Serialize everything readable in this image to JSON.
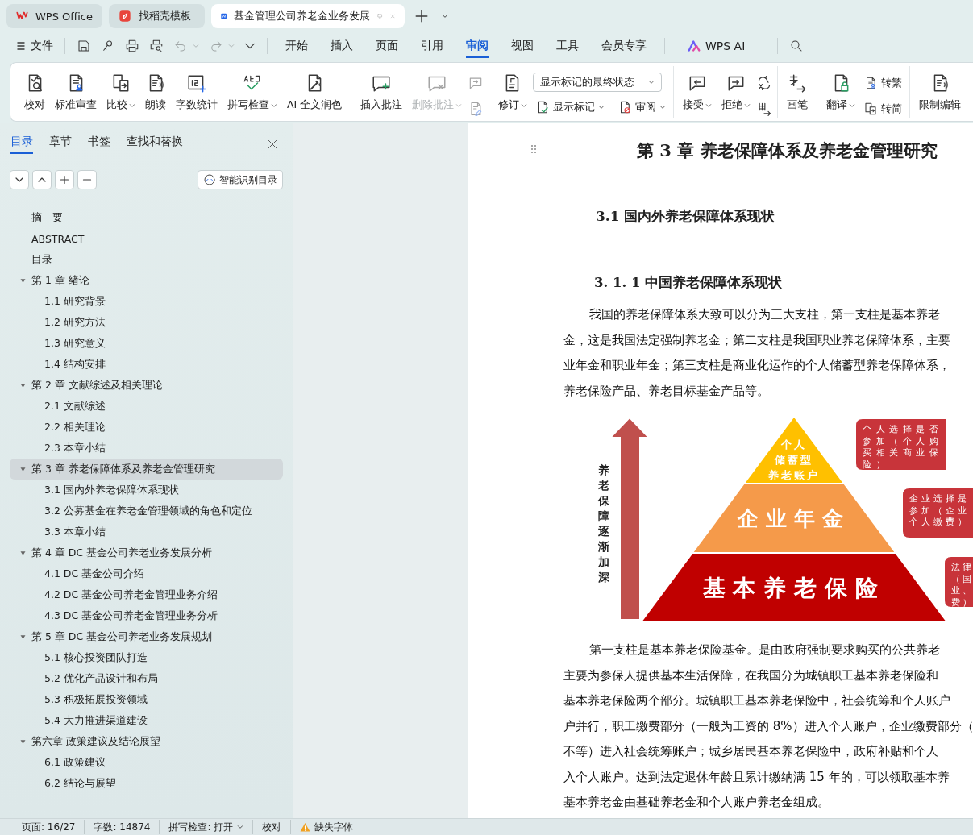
{
  "browser_tabs": [
    {
      "title": "WPS Office",
      "selected": false
    },
    {
      "title": "找稻壳模板",
      "selected": false
    },
    {
      "title": "基金管理公司养老金业务发展",
      "selected": true
    }
  ],
  "menu": {
    "file": "文件",
    "tabs": [
      {
        "label": "开始",
        "selected": false
      },
      {
        "label": "插入",
        "selected": false
      },
      {
        "label": "页面",
        "selected": false
      },
      {
        "label": "引用",
        "selected": false
      },
      {
        "label": "审阅",
        "selected": true
      },
      {
        "label": "视图",
        "selected": false
      },
      {
        "label": "工具",
        "selected": false
      },
      {
        "label": "会员专享",
        "selected": false
      }
    ],
    "ai": "WPS AI"
  },
  "ribbon": {
    "groups": [
      {
        "items": [
          {
            "kind": "large",
            "label": "校对",
            "dropdown": false,
            "disabled": false
          },
          {
            "kind": "large",
            "label": "标准审查",
            "dropdown": false,
            "disabled": false
          },
          {
            "kind": "large",
            "label": "比较",
            "dropdown": true,
            "disabled": false
          },
          {
            "kind": "large",
            "label": "朗读",
            "dropdown": false,
            "disabled": false
          },
          {
            "kind": "large",
            "label": "字数统计",
            "dropdown": false,
            "disabled": false
          },
          {
            "kind": "large",
            "label": "拼写检查",
            "dropdown": true,
            "disabled": false
          },
          {
            "kind": "large",
            "label": "AI 全文润色",
            "dropdown": false,
            "disabled": false
          }
        ]
      },
      {
        "items": [
          {
            "kind": "large",
            "label": "插入批注",
            "dropdown": false,
            "disabled": false
          },
          {
            "kind": "large",
            "label": "删除批注",
            "dropdown": true,
            "disabled": true
          },
          {
            "kind": "stack",
            "rows": [
              [
                {
                  "kind": "icon",
                  "disabled": true
                }
              ],
              [
                {
                  "kind": "icon",
                  "disabled": true
                }
              ]
            ]
          }
        ]
      },
      {
        "items": [
          {
            "kind": "large",
            "label": "修订",
            "dropdown": true,
            "disabled": false
          },
          {
            "kind": "stack",
            "rows": [
              [
                {
                  "kind": "select",
                  "value": "显示标记的最终状态"
                }
              ],
              [
                {
                  "kind": "small",
                  "label": "显示标记",
                  "dropdown": true,
                  "disabled": false
                },
                {
                  "kind": "small",
                  "label": "审阅",
                  "dropdown": true,
                  "disabled": false
                }
              ]
            ]
          }
        ]
      },
      {
        "items": [
          {
            "kind": "large",
            "label": "接受",
            "dropdown": true,
            "disabled": false
          },
          {
            "kind": "large",
            "label": "拒绝",
            "dropdown": true,
            "disabled": false
          },
          {
            "kind": "stack",
            "rows": [
              [
                {
                  "kind": "icon",
                  "disabled": false
                }
              ],
              [
                {
                  "kind": "icon",
                  "disabled": false
                }
              ]
            ]
          }
        ]
      },
      {
        "items": [
          {
            "kind": "large",
            "label": "画笔",
            "dropdown": false,
            "disabled": false
          }
        ]
      },
      {
        "items": [
          {
            "kind": "large",
            "label": "翻译",
            "dropdown": true,
            "disabled": false
          },
          {
            "kind": "stack",
            "rows": [
              [
                {
                  "kind": "small",
                  "label": "转繁",
                  "dropdown": false,
                  "disabled": false
                }
              ],
              [
                {
                  "kind": "small",
                  "label": "转简",
                  "dropdown": false,
                  "disabled": false
                }
              ]
            ]
          }
        ]
      },
      {
        "items": [
          {
            "kind": "large",
            "label": "限制编辑",
            "dropdown": false,
            "disabled": false
          }
        ]
      }
    ]
  },
  "sidebar": {
    "tabs": [
      {
        "label": "目录",
        "selected": true
      },
      {
        "label": "章节",
        "selected": false
      },
      {
        "label": "书签",
        "selected": false
      },
      {
        "label": "查找和替换",
        "selected": false
      }
    ],
    "smart_toc": "智能识别目录",
    "toc": [
      {
        "label": "摘　要",
        "selected": false
      },
      {
        "label": "ABSTRACT",
        "selected": false
      },
      {
        "label": "目录",
        "selected": false
      },
      {
        "label": "第 1 章  绪论",
        "selected": false,
        "expanded": true,
        "children": [
          {
            "label": "1.1  研究背景",
            "selected": false
          },
          {
            "label": "1.2  研究方法",
            "selected": false
          },
          {
            "label": "1.3  研究意义",
            "selected": false
          },
          {
            "label": "1.4  结构安排",
            "selected": false
          }
        ]
      },
      {
        "label": "第 2 章  文献综述及相关理论",
        "selected": false,
        "expanded": true,
        "children": [
          {
            "label": "2.1 文献综述",
            "selected": false
          },
          {
            "label": "2.2  相关理论",
            "selected": false
          },
          {
            "label": "2.3  本章小结",
            "selected": false
          }
        ]
      },
      {
        "label": "第 3 章  养老保障体系及养老金管理研究",
        "selected": true,
        "expanded": true,
        "children": [
          {
            "label": "3.1  国内外养老保障体系现状",
            "selected": false
          },
          {
            "label": "3.2  公募基金在养老金管理领域的角色和定位",
            "selected": false
          },
          {
            "label": "3.3  本章小结",
            "selected": false
          }
        ]
      },
      {
        "label": "第 4 章  DC 基金公司养老业务发展分析",
        "selected": false,
        "expanded": true,
        "children": [
          {
            "label": "4.1 DC 基金公司介绍",
            "selected": false
          },
          {
            "label": "4.2 DC 基金公司养老金管理业务介绍",
            "selected": false
          },
          {
            "label": "4.3 DC 基金公司养老金管理业务分析",
            "selected": false
          }
        ]
      },
      {
        "label": "第 5 章  DC 基金公司养老业务发展规划",
        "selected": false,
        "expanded": true,
        "children": [
          {
            "label": "5.1  核心投资团队打造",
            "selected": false
          },
          {
            "label": "5.2  优化产品设计和布局",
            "selected": false
          },
          {
            "label": "5.3  积极拓展投资领域",
            "selected": false
          },
          {
            "label": "5.4  大力推进渠道建设",
            "selected": false
          }
        ]
      },
      {
        "label": "第六章  政策建议及结论展望",
        "selected": false,
        "expanded": true,
        "children": [
          {
            "label": "6.1  政策建议",
            "selected": false
          },
          {
            "label": "6.2  结论与展望",
            "selected": false
          }
        ]
      }
    ]
  },
  "document": {
    "blocks": [
      {
        "kind": "h1",
        "text": "第 3 章  养老保障体系及养老金管理研究"
      },
      {
        "kind": "h2",
        "text": "3.1  国内外养老保障体系现状"
      },
      {
        "kind": "h3",
        "text": "3. 1. 1  中国养老保障体系现状"
      },
      {
        "kind": "para",
        "lines": [
          "我国的养老保障体系大致可以分为三大支柱，第一支柱是基本养老",
          "金，这是我国法定强制养老金；第二支柱是我国职业养老保障体系，主要",
          "业年金和职业年金；第三支柱是商业化运作的个人储蓄型养老保障体系，",
          "养老保险产品、养老目标基金产品等。"
        ]
      },
      {
        "kind": "figure",
        "axis_label": "养老保障逐渐加深",
        "tiers": [
          {
            "lines": [
              "个人",
              "储蓄型",
              "养老账户"
            ],
            "color": "#ffc000"
          },
          {
            "lines": [
              "企业年金"
            ],
            "color": "#f59a4a"
          },
          {
            "lines": [
              "基本养老保险"
            ],
            "color": "#c00000"
          }
        ],
        "callouts": [
          {
            "lines": [
              "个人选择是否",
              "参加（个人购",
              "买相关商业保",
              "险）"
            ]
          },
          {
            "lines": [
              "企业选择是",
              "参加（企业",
              "个人缴费）"
            ]
          },
          {
            "lines": [
              "法律",
              "（国",
              "业、",
              "费）"
            ]
          }
        ]
      },
      {
        "kind": "para",
        "lines": [
          "第一支柱是基本养老保险基金。是由政府强制要求购买的公共养老",
          "主要为参保人提供基本生活保障，在我国分为城镇职工基本养老保险和",
          "基本养老保险两个部分。城镇职工基本养老保险中，社会统筹和个人账户",
          "户并行，职工缴费部分（一般为工资的 8%）进入个人账户，企业缴费部分（",
          "不等）进入社会统筹账户；城乡居民基本养老保险中，政府补贴和个人",
          "入个人账户。达到法定退休年龄且累计缴纳满 15 年的，可以领取基本养",
          "基本养老金由基础养老金和个人账户养老金组成。"
        ]
      }
    ]
  },
  "status_bar": [
    {
      "kind": "text",
      "text": "页面: 16/27"
    },
    {
      "kind": "text",
      "text": "字数: 14874"
    },
    {
      "kind": "dropdown",
      "text": "拼写检查: 打开"
    },
    {
      "kind": "text",
      "text": "校对"
    },
    {
      "kind": "warning",
      "text": "缺失字体"
    }
  ]
}
